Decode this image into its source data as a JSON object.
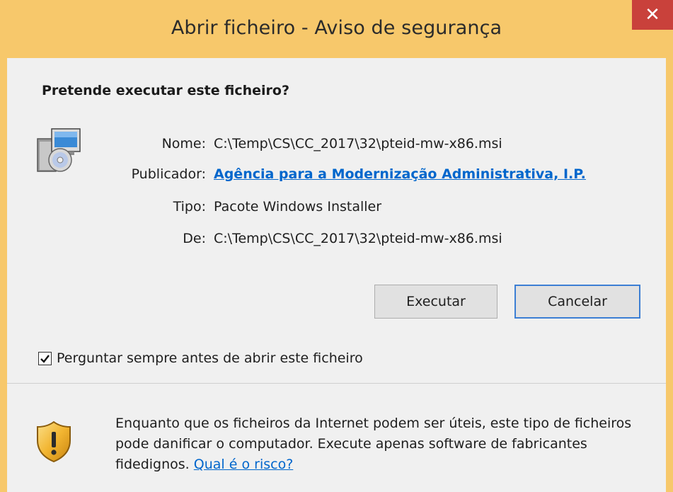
{
  "window": {
    "title": "Abrir ficheiro - Aviso de segurança",
    "close_glyph": "✕"
  },
  "dialog": {
    "heading": "Pretende executar este ficheiro?",
    "file_icon": "installer-package-icon",
    "fields": {
      "name_label": "Nome:",
      "name_value": "C:\\Temp\\CS\\CC_2017\\32\\pteid-mw-x86.msi",
      "publisher_label": "Publicador:",
      "publisher_value": "Agência para a Modernização Administrativa, I.P.",
      "type_label": "Tipo:",
      "type_value": "Pacote Windows Installer",
      "from_label": "De:",
      "from_value": "C:\\Temp\\CS\\CC_2017\\32\\pteid-mw-x86.msi"
    },
    "buttons": {
      "run_label": "Executar",
      "cancel_label": "Cancelar"
    },
    "checkbox": {
      "label": "Perguntar sempre antes de abrir este ficheiro",
      "checked": true
    },
    "warning": {
      "icon": "security-shield-icon",
      "text": "Enquanto que os ficheiros da Internet podem ser úteis, este tipo de ficheiros pode danificar o computador. Execute apenas software de fabricantes fidedignos.",
      "link_label": "Qual é o risco?"
    }
  },
  "colors": {
    "frame": "#f7c86b",
    "close_button": "#c9413b",
    "client_background": "#f0f0f0",
    "link": "#0066cc",
    "default_button_border": "#3c7fd4"
  }
}
